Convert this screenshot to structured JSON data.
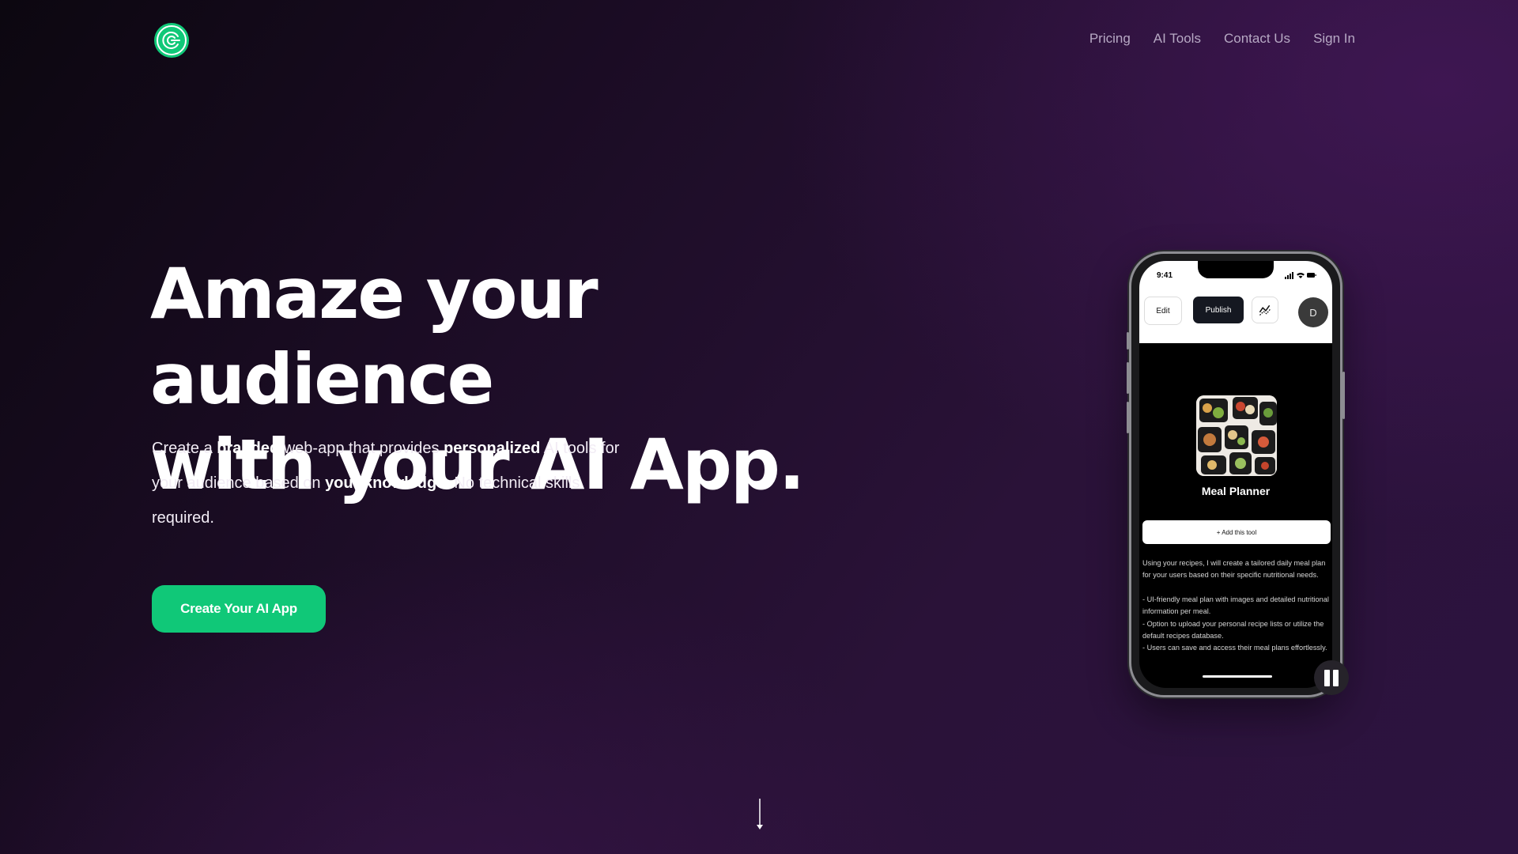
{
  "nav": {
    "items": [
      {
        "label": "Pricing"
      },
      {
        "label": "AI Tools"
      },
      {
        "label": "Contact Us"
      },
      {
        "label": "Sign In"
      }
    ]
  },
  "hero": {
    "title_line1": "Amaze your audience",
    "title_line2": "with your AI App.",
    "sub": {
      "t1": "Create a ",
      "b1": "branded",
      "t2": " web-app that provides ",
      "b2": "personalized",
      "t3": " AI tools for your audience based on ",
      "b3": "your knowledge.",
      "t4": " No technical skills required."
    },
    "cta_label": "Create Your AI App"
  },
  "phone": {
    "time": "9:41",
    "toolbar": {
      "edit_label": "Edit",
      "publish_label": "Publish",
      "avatar_initial": "D"
    },
    "tool": {
      "name": "Meal Planner",
      "add_label": "+ Add this tool",
      "description": "Using your recipes, I will create a tailored daily meal plan for your users based on their specific nutritional needs.",
      "bullets": [
        "- UI-friendly meal plan with images and detailed nutritional information per meal.",
        "- Option to upload your personal recipe lists or utilize the default recipes database.",
        "- Users can save and access their meal plans effortlessly."
      ]
    }
  },
  "colors": {
    "accent": "#10c878",
    "background": "#23102f",
    "nav_text": "#b7a9c4"
  },
  "icons": {
    "logo": "concentric-circles-logo-icon",
    "scroll": "arrow-down-icon",
    "pause": "pause-icon",
    "analytics": "analytics-icon"
  }
}
